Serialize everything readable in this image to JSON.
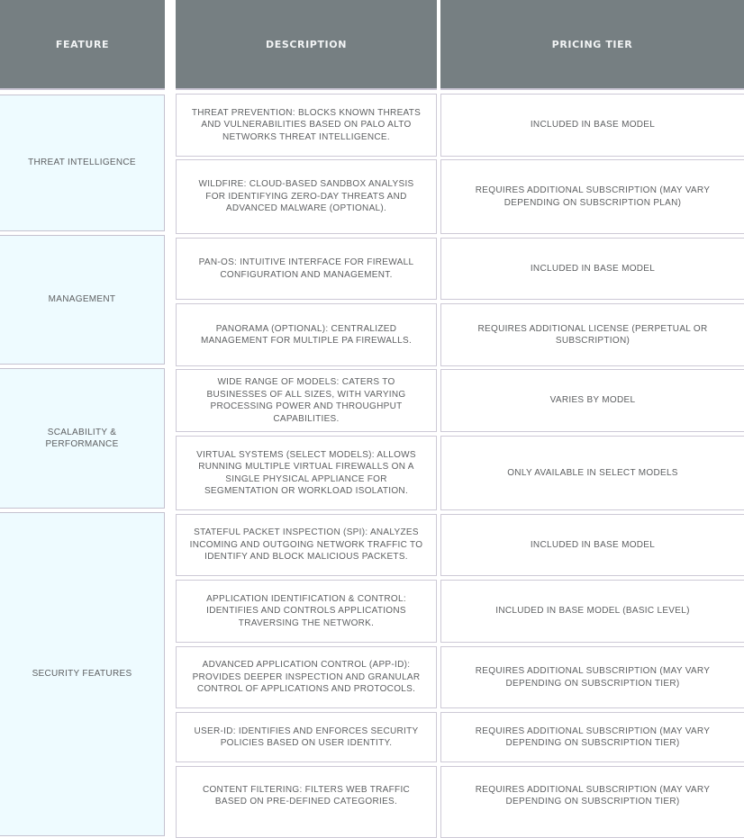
{
  "headers": {
    "feature": "FEATURE",
    "description": "DESCRIPTION",
    "pricing": "PRICING TIER"
  },
  "groups": [
    {
      "feature": "THREAT INTELLIGENCE",
      "rows": [
        {
          "description": "THREAT PREVENTION: BLOCKS KNOWN THREATS AND VULNERABILITIES BASED ON PALO ALTO NETWORKS THREAT INTELLIGENCE.",
          "pricing": "INCLUDED IN BASE MODEL"
        },
        {
          "description": "WILDFIRE: CLOUD-BASED SANDBOX ANALYSIS FOR IDENTIFYING ZERO-DAY THREATS AND ADVANCED MALWARE (OPTIONAL).",
          "pricing": "REQUIRES ADDITIONAL SUBSCRIPTION (MAY VARY DEPENDING ON SUBSCRIPTION PLAN)"
        }
      ]
    },
    {
      "feature": "MANAGEMENT",
      "rows": [
        {
          "description": "PAN-OS: INTUITIVE INTERFACE FOR FIREWALL CONFIGURATION AND MANAGEMENT.",
          "pricing": "INCLUDED IN BASE MODEL"
        },
        {
          "description": "PANORAMA (OPTIONAL): CENTRALIZED MANAGEMENT FOR MULTIPLE PA FIREWALLS.",
          "pricing": "REQUIRES ADDITIONAL LICENSE (PERPETUAL OR SUBSCRIPTION)"
        }
      ]
    },
    {
      "feature": "SCALABILITY & PERFORMANCE",
      "rows": [
        {
          "description": "WIDE RANGE OF MODELS: CATERS TO BUSINESSES OF ALL SIZES, WITH VARYING PROCESSING POWER AND THROUGHPUT CAPABILITIES.",
          "pricing": "VARIES BY MODEL"
        },
        {
          "description": "VIRTUAL SYSTEMS (SELECT MODELS): ALLOWS RUNNING MULTIPLE VIRTUAL FIREWALLS ON A SINGLE PHYSICAL APPLIANCE FOR SEGMENTATION OR WORKLOAD ISOLATION.",
          "pricing": "ONLY AVAILABLE IN SELECT MODELS"
        }
      ]
    },
    {
      "feature": "SECURITY FEATURES",
      "rows": [
        {
          "description": "STATEFUL PACKET INSPECTION (SPI): ANALYZES INCOMING AND OUTGOING NETWORK TRAFFIC TO IDENTIFY AND BLOCK MALICIOUS PACKETS.",
          "pricing": "INCLUDED IN BASE MODEL"
        },
        {
          "description": "APPLICATION IDENTIFICATION & CONTROL: IDENTIFIES AND CONTROLS APPLICATIONS TRAVERSING THE NETWORK.",
          "pricing": "INCLUDED IN BASE MODEL (BASIC LEVEL)"
        },
        {
          "description": "ADVANCED APPLICATION CONTROL (APP-ID): PROVIDES DEEPER INSPECTION AND GRANULAR CONTROL OF APPLICATIONS AND PROTOCOLS.",
          "pricing": "REQUIRES ADDITIONAL SUBSCRIPTION (MAY VARY DEPENDING ON SUBSCRIPTION TIER)"
        },
        {
          "description": "USER-ID: IDENTIFIES AND ENFORCES SECURITY POLICIES BASED ON USER IDENTITY.",
          "pricing": "REQUIRES ADDITIONAL SUBSCRIPTION (MAY VARY DEPENDING ON SUBSCRIPTION TIER)"
        },
        {
          "description": "CONTENT FILTERING: FILTERS WEB TRAFFIC BASED ON PRE-DEFINED CATEGORIES.",
          "pricing": "REQUIRES ADDITIONAL SUBSCRIPTION (MAY VARY DEPENDING ON SUBSCRIPTION TIER)"
        }
      ]
    }
  ]
}
